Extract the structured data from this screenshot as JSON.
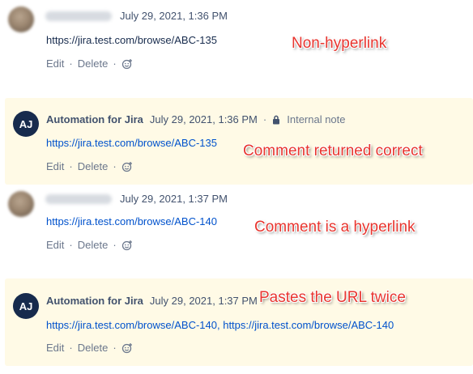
{
  "colors": {
    "internal_bg": "#fffae6",
    "link": "#0052cc",
    "annotation": "#e8352f",
    "avatar_bg": "#172b4d"
  },
  "comments": [
    {
      "timestamp": "July 29, 2021, 1:36 PM",
      "body": "https://jira.test.com/browse/ABC-135",
      "edit": "Edit",
      "delete": "Delete",
      "annotation": "Non-hyperlink"
    },
    {
      "author": "Automation for Jira",
      "initials": "AJ",
      "timestamp": "July 29, 2021, 1:36 PM",
      "visibility": "Internal note",
      "body": "https://jira.test.com/browse/ABC-135",
      "edit": "Edit",
      "delete": "Delete",
      "annotation": "Comment returned correct"
    },
    {
      "timestamp": "July 29, 2021, 1:37 PM",
      "body": "https://jira.test.com/browse/ABC-140",
      "edit": "Edit",
      "delete": "Delete",
      "annotation": "Comment is a hyperlink"
    },
    {
      "author": "Automation for Jira",
      "initials": "AJ",
      "timestamp": "July 29, 2021, 1:37 PM",
      "body_links": [
        "https://jira.test.com/browse/ABC-140,",
        "https://jira.test.com/browse/ABC-140"
      ],
      "edit": "Edit",
      "delete": "Delete",
      "annotation": "Pastes the URL twice"
    }
  ],
  "separator": "·",
  "icons": {
    "reaction": "add-reaction-icon",
    "lock": "lock-icon"
  }
}
